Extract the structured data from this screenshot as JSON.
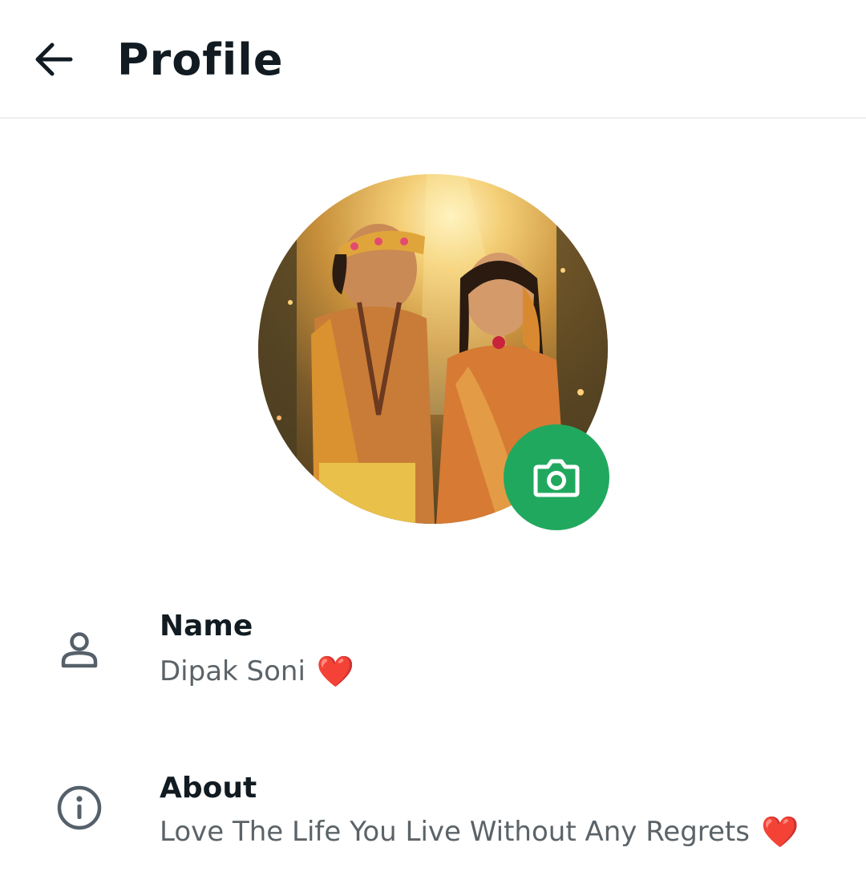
{
  "header": {
    "title": "Profile",
    "back_icon": "arrow-left-icon"
  },
  "avatar": {
    "camera_icon": "camera-icon",
    "accent_color": "#21a85f"
  },
  "fields": [
    {
      "icon": "person-icon",
      "label": "Name",
      "value": "Dipak Soni",
      "emoji": "❤️"
    },
    {
      "icon": "info-icon",
      "label": "About",
      "value": "Love The Life You Live Without Any Regrets",
      "emoji": "❤️"
    }
  ]
}
